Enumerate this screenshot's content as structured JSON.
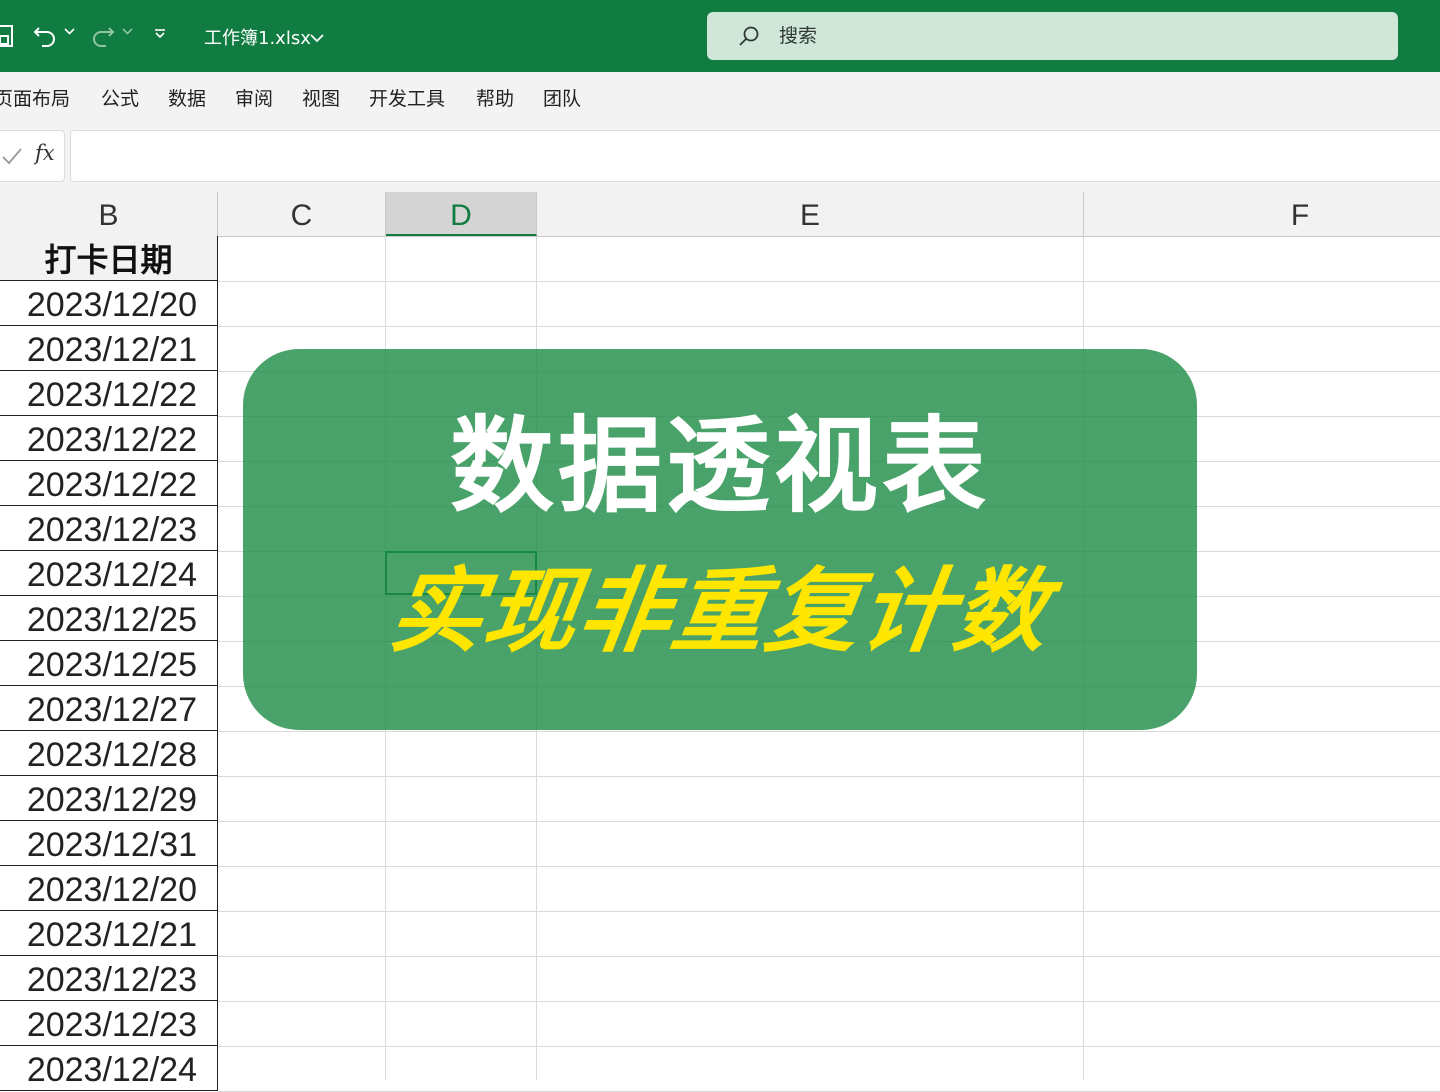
{
  "titlebar": {
    "filename": "工作簿1.xlsx",
    "search_placeholder": "搜索"
  },
  "ribbon": {
    "tabs": [
      "页面布局",
      "公式",
      "数据",
      "审阅",
      "视图",
      "开发工具",
      "帮助",
      "团队"
    ]
  },
  "formula_bar": {
    "fx_label": "fx",
    "value": ""
  },
  "columns": [
    "B",
    "C",
    "D",
    "E",
    "F"
  ],
  "selected_column": "D",
  "column_b": {
    "header": "打卡日期",
    "values": [
      "2023/12/20",
      "2023/12/21",
      "2023/12/22",
      "2023/12/22",
      "2023/12/22",
      "2023/12/23",
      "2023/12/24",
      "2023/12/25",
      "2023/12/25",
      "2023/12/27",
      "2023/12/28",
      "2023/12/29",
      "2023/12/31",
      "2023/12/20",
      "2023/12/21",
      "2023/12/23",
      "2023/12/23",
      "2023/12/24"
    ]
  },
  "banner": {
    "title": "数据透视表",
    "subtitle": "实现非重复计数",
    "title_color": "#ffffff",
    "subtitle_color": "#ffe600",
    "background": "#1c8b44"
  },
  "colors": {
    "accent": "#107c41"
  }
}
